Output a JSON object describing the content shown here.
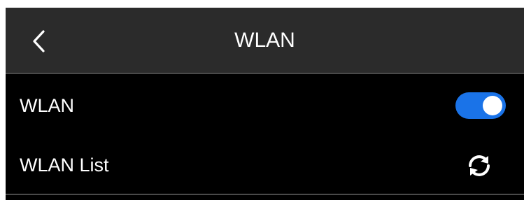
{
  "header": {
    "title": "WLAN",
    "back_icon": "chevron-left-icon"
  },
  "settings": [
    {
      "label": "WLAN",
      "control": "toggle",
      "state": "on",
      "accent_color": "#1a73e8"
    },
    {
      "label": "WLAN List",
      "control": "refresh",
      "icon": "refresh-icon"
    }
  ],
  "colors": {
    "header_bg": "#2b2b2b",
    "content_bg": "#000000",
    "text": "#ffffff",
    "divider": "#4a4a4a"
  }
}
